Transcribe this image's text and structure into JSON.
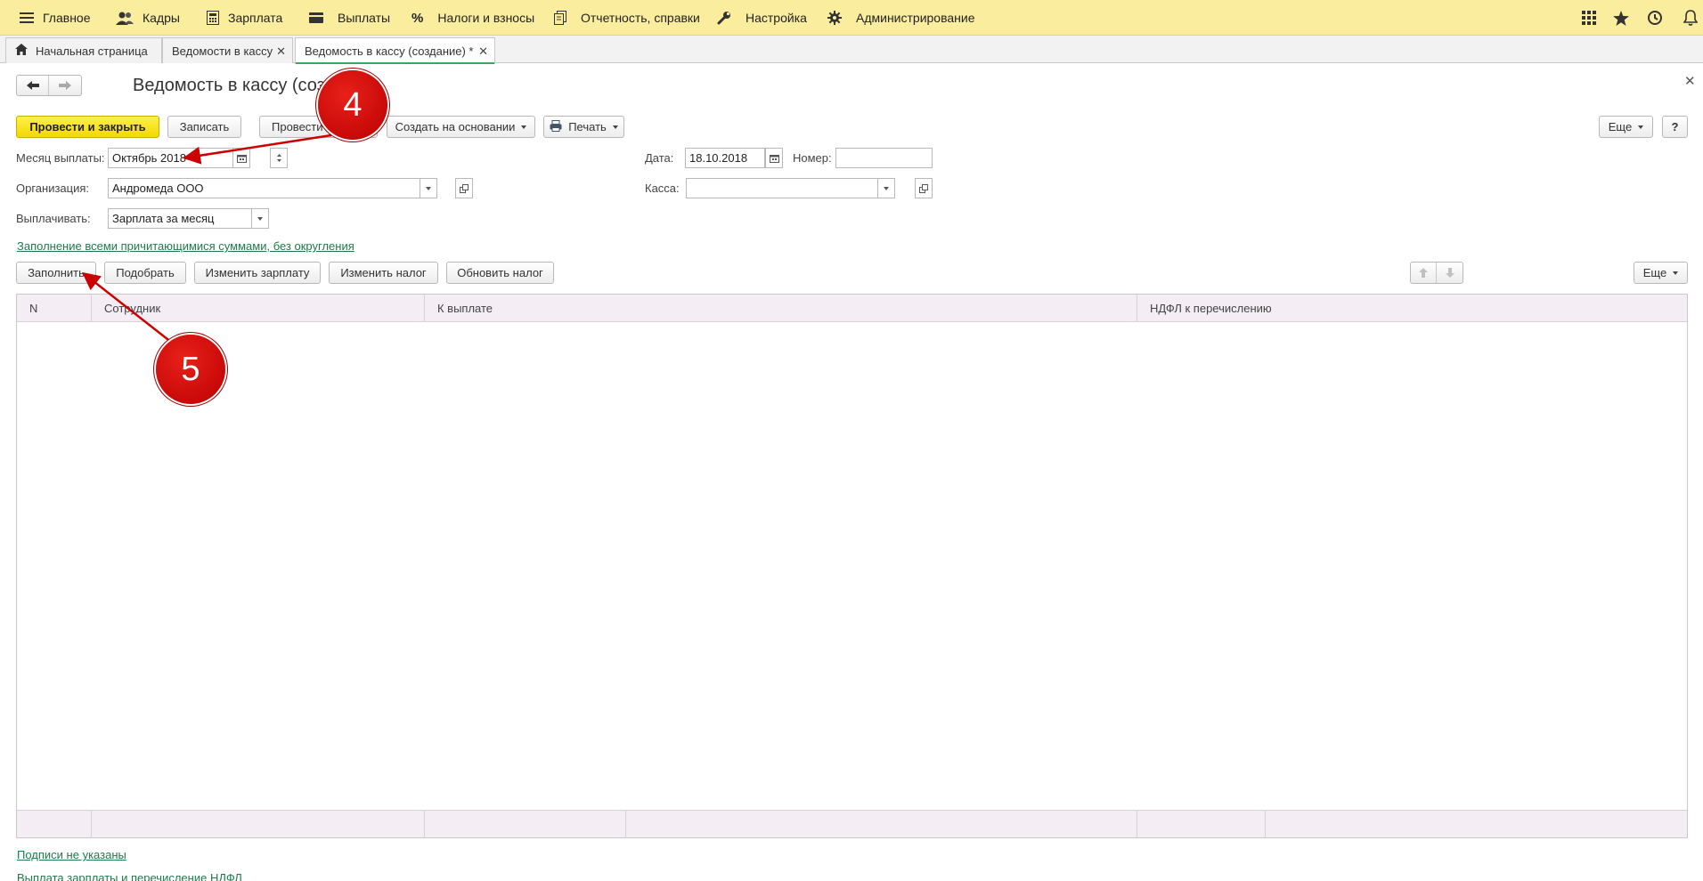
{
  "menu": {
    "items": [
      {
        "label": "Главное",
        "icon": "hamburger-icon"
      },
      {
        "label": "Кадры",
        "icon": "people-icon"
      },
      {
        "label": "Зарплата",
        "icon": "calculator-icon"
      },
      {
        "label": "Выплаты",
        "icon": "wallet-icon"
      },
      {
        "label": "Налоги и взносы",
        "icon": "percent-icon"
      },
      {
        "label": "Отчетность, справки",
        "icon": "documents-icon"
      },
      {
        "label": "Настройка",
        "icon": "wrench-icon"
      },
      {
        "label": "Администрирование",
        "icon": "gear-icon"
      }
    ]
  },
  "tabs": [
    {
      "label": "Начальная страница",
      "icon": "home-icon"
    },
    {
      "label": "Ведомости в кассу"
    },
    {
      "label": "Ведомость в кассу (создание) *"
    }
  ],
  "form": {
    "title": "Ведомость в кассу (создание)",
    "toolbar": {
      "post_and_close": "Провести и закрыть",
      "save": "Записать",
      "post": "Провести",
      "create_based_on": "Создать на основании",
      "print": "Печать",
      "more": "Еще",
      "help": "?"
    },
    "fields": {
      "month_label": "Месяц выплаты:",
      "month_value": "Октябрь 2018",
      "date_label": "Дата:",
      "date_value": "18.10.2018",
      "number_label": "Номер:",
      "number_value": "",
      "org_label": "Организация:",
      "org_value": "Андромеда ООО",
      "cash_label": "Касса:",
      "cash_value": "",
      "pay_label": "Выплачивать:",
      "pay_value": "Зарплата за месяц"
    },
    "fill_mode_link": "Заполнение всеми причитающимися суммами, без округления",
    "table_toolbar": {
      "fill": "Заполнить",
      "pick": "Подобрать",
      "change_salary": "Изменить зарплату",
      "change_tax": "Изменить налог",
      "update_tax": "Обновить налог",
      "more": "Еще"
    },
    "table": {
      "columns": [
        "N",
        "Сотрудник",
        "К выплате",
        "НДФЛ к перечислению"
      ],
      "rows": []
    },
    "signatures_link": "Подписи не указаны",
    "bottom_link": "Выплата зарплаты и перечисление НДФЛ"
  },
  "annotations": {
    "badge1": "4",
    "badge2": "5",
    "color": "#cc0000"
  }
}
